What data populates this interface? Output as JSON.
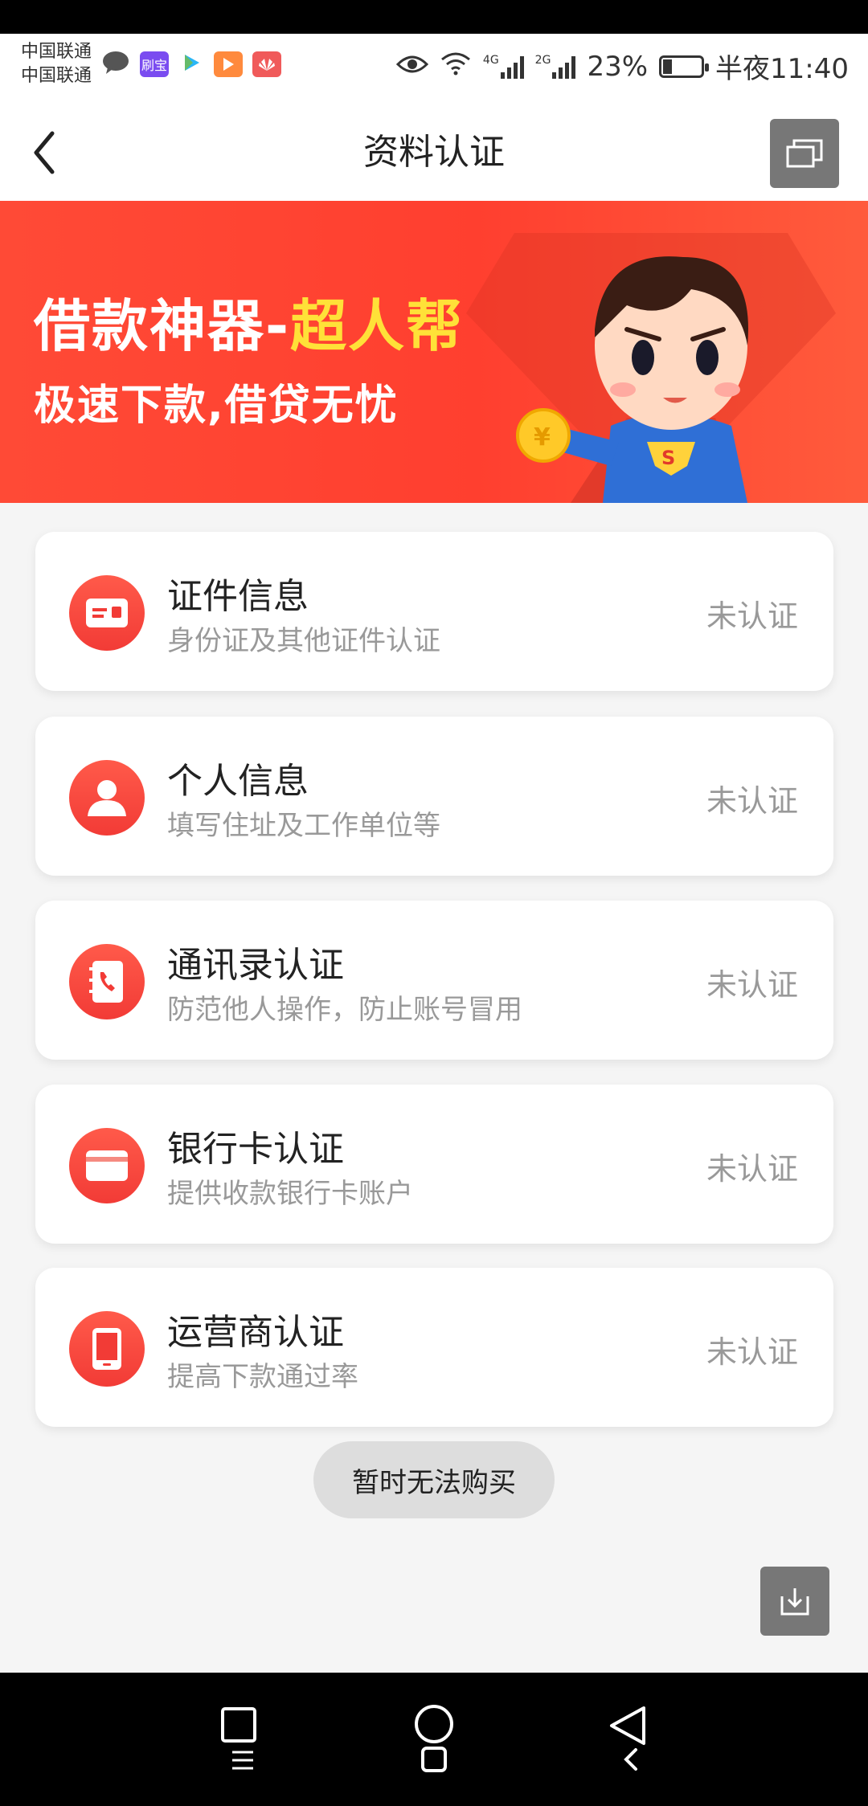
{
  "status_bar": {
    "carrier_1": "中国联通",
    "carrier_2": "中国联通",
    "app_badge": "刷宝",
    "network_1": "4G",
    "network_2": "2G",
    "battery": "23%",
    "battery_level": 0.23,
    "time": "半夜11:40"
  },
  "header": {
    "title": "资料认证"
  },
  "banner": {
    "title_part1": "借款神器-",
    "title_part2": "超人帮",
    "subtitle": "极速下款,借贷无忧",
    "coin_symbol": "¥"
  },
  "items": [
    {
      "name": "证件信息",
      "desc": "身份证及其他证件认证",
      "status": "未认证",
      "icon": "id-card-icon"
    },
    {
      "name": "个人信息",
      "desc": "填写住址及工作单位等",
      "status": "未认证",
      "icon": "person-icon"
    },
    {
      "name": "通讯录认证",
      "desc": "防范他人操作，防止账号冒用",
      "status": "未认证",
      "icon": "contacts-phone-icon"
    },
    {
      "name": "银行卡认证",
      "desc": "提供收款银行卡账户",
      "status": "未认证",
      "icon": "bank-card-icon"
    },
    {
      "name": "运营商认证",
      "desc": "提高下款通过率",
      "status": "未认证",
      "icon": "mobile-phone-icon"
    }
  ],
  "buy_button": {
    "label": "暂时无法购买"
  },
  "colors": {
    "accent": "#f23b36",
    "banner": "#ff4a36",
    "banner_highlight": "#ffe138"
  }
}
